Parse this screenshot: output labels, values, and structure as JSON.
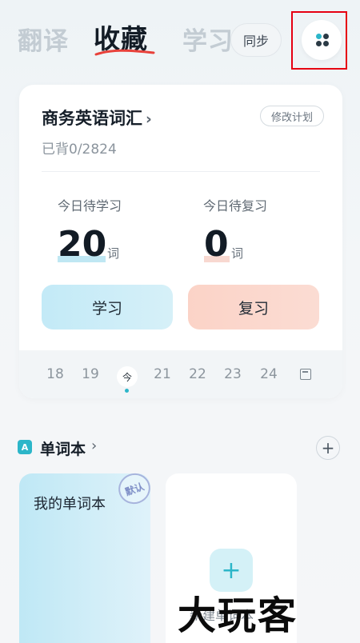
{
  "tabs": {
    "translate": "翻译",
    "favorites": "收藏",
    "study": "学习"
  },
  "top": {
    "sync_label": "同步"
  },
  "plan": {
    "book_title": "商务英语词汇",
    "modify_label": "修改计划",
    "progress": "已背0/2824",
    "today_learn_label": "今日待学习",
    "today_learn_count": "20",
    "today_review_label": "今日待复习",
    "today_review_count": "0",
    "unit": "词",
    "learn_button": "学习",
    "review_button": "复习"
  },
  "calendar": {
    "days": [
      "18",
      "19",
      "今",
      "21",
      "22",
      "23",
      "24"
    ],
    "today_index": 2
  },
  "wordbook": {
    "section_title": "单词本",
    "icon_letter": "A",
    "books": [
      {
        "name": "我的单词本",
        "badge": "默认"
      }
    ],
    "new_label": "新建单词本"
  },
  "watermark": "大玩客",
  "colors": {
    "accent": "#2cb6c9",
    "learn": "#c3eaf7",
    "review": "#fbd3c7",
    "highlight": "#e60012"
  }
}
